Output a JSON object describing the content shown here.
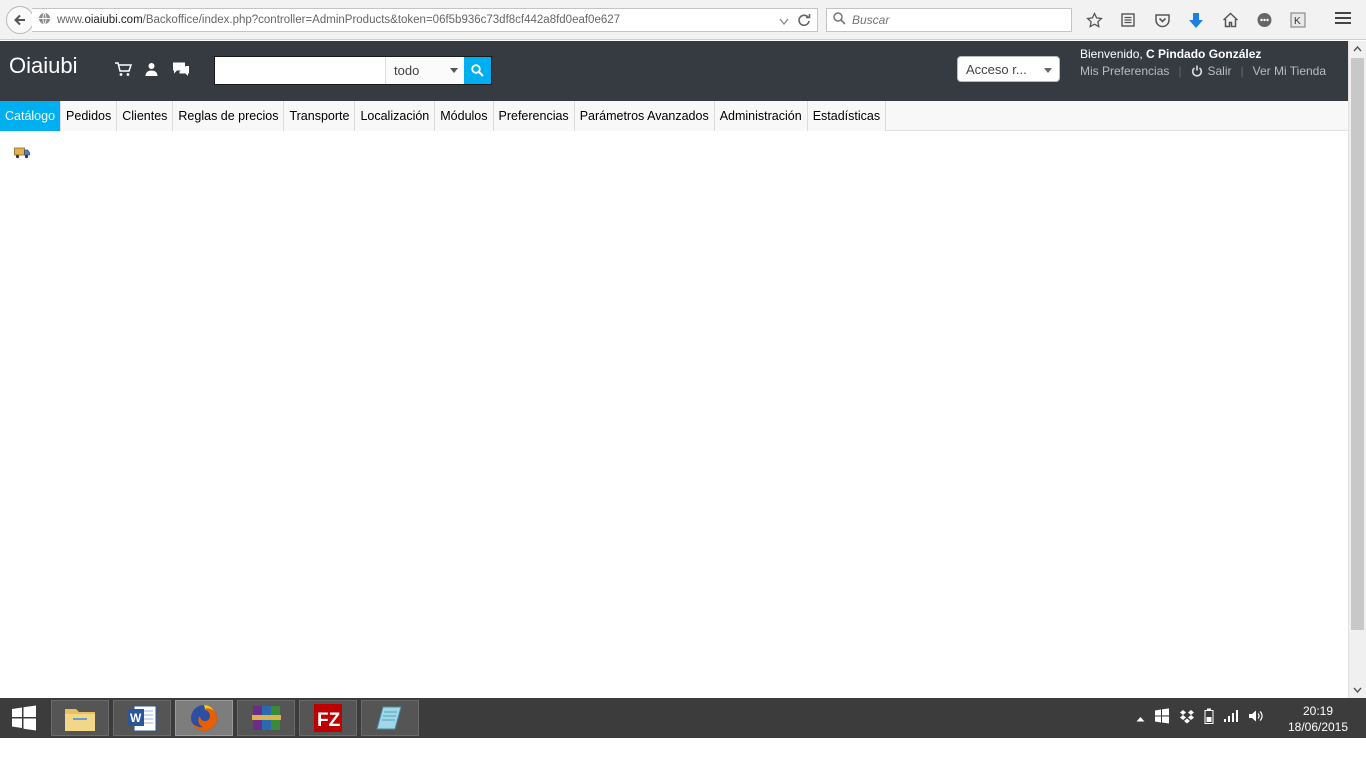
{
  "browser": {
    "url_prefix": "www.",
    "url_domain": "oiaiubi.com",
    "url_path": "/Backoffice/index.php?controller=AdminProducts&token=06f5b936c73df8cf442a8fd0eaf0e627",
    "search_placeholder": "Buscar"
  },
  "header": {
    "shop_name": "Oiaiubi",
    "search_value": "",
    "search_scope": "todo",
    "quick_access": "Acceso r...",
    "welcome_prefix": "Bienvenido, ",
    "employee_name": "C Pindado González",
    "my_preferences": "Mis Preferencias",
    "logout": "Salir",
    "view_shop": "Ver Mi Tienda"
  },
  "menu": {
    "items": [
      {
        "label": "Catálogo"
      },
      {
        "label": "Pedidos"
      },
      {
        "label": "Clientes"
      },
      {
        "label": "Reglas de precios"
      },
      {
        "label": "Transporte"
      },
      {
        "label": "Localización"
      },
      {
        "label": "Módulos"
      },
      {
        "label": "Preferencias"
      },
      {
        "label": "Parámetros Avanzados"
      },
      {
        "label": "Administración"
      },
      {
        "label": "Estadísticas"
      }
    ],
    "active": "Catálogo"
  },
  "taskbar": {
    "apps": [
      "file-explorer-icon",
      "word-icon",
      "firefox-icon",
      "winrar-icon",
      "filezilla-icon",
      "notepad-icon"
    ],
    "active_app": "firefox-icon",
    "time": "20:19",
    "date": "18/06/2015"
  },
  "colors": {
    "header_bg": "#363a41",
    "accent": "#00aff0",
    "taskbar_bg": "#3c3c3c"
  }
}
